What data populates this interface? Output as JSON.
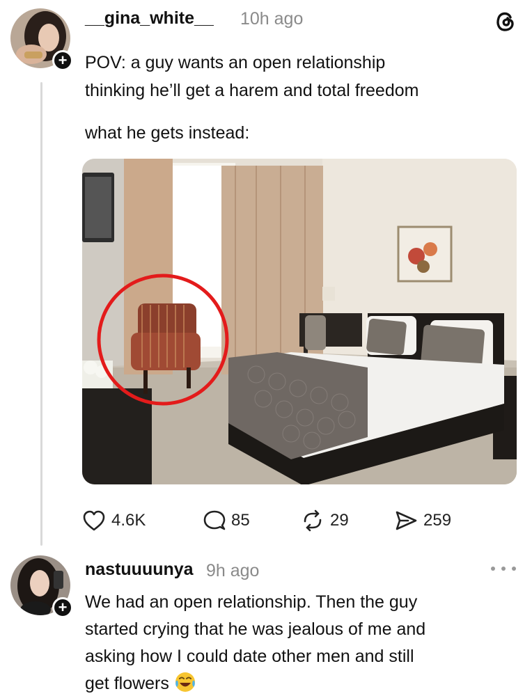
{
  "post": {
    "username": "__gina_white__",
    "timestamp": "10h ago",
    "line1": "POV: a guy wants an open relationship",
    "line2": "thinking he’ll get a harem and total freedom",
    "line3": "what he gets instead:",
    "follow_symbol": "+",
    "actions": {
      "likes": "4.6K",
      "comments": "85",
      "reposts": "29",
      "shares": "259"
    }
  },
  "reply": {
    "username": "nastuuuunya",
    "timestamp": "9h ago",
    "follow_symbol": "+",
    "line1": "We had an open relationship. Then the guy",
    "line2": "started crying that he was jealous of me and",
    "line3": "asking how I could date other men and still",
    "line4": "get flowers",
    "emoji": "face-with-tears-of-joy"
  },
  "icons": {
    "app_logo": "threads-logo-icon",
    "like": "heart-icon",
    "comment": "comment-bubble-icon",
    "repost": "repost-icon",
    "share": "send-icon",
    "more": "more-horizontal-icon"
  },
  "colors": {
    "highlight_circle": "#e31b1b",
    "muted_text": "#8a8a8a"
  }
}
